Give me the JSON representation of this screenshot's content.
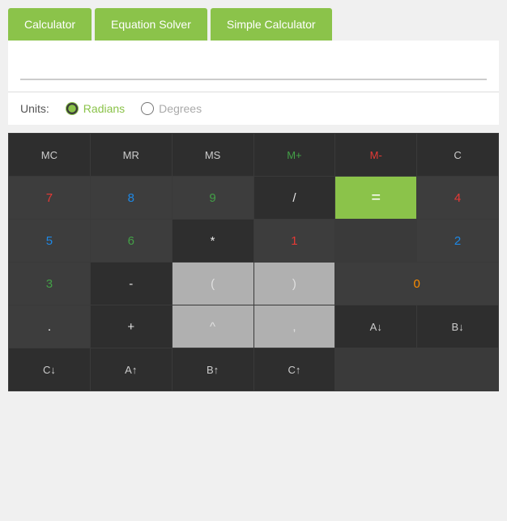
{
  "tabs": [
    {
      "label": "Calculator",
      "id": "calculator",
      "active": false
    },
    {
      "label": "Equation Solver",
      "id": "equation-solver",
      "active": true
    },
    {
      "label": "Simple Calculator",
      "id": "simple-calculator",
      "active": false
    }
  ],
  "display": {
    "value": "",
    "placeholder": ""
  },
  "units": {
    "label": "Units:",
    "options": [
      {
        "label": "Radians",
        "value": "radians",
        "checked": true
      },
      {
        "label": "Degrees",
        "value": "degrees",
        "checked": false
      }
    ]
  },
  "memory_row": [
    "MC",
    "MR",
    "MS",
    "M+",
    "M-",
    "C"
  ],
  "buttons": {
    "row1": [
      {
        "label": "7",
        "type": "number"
      },
      {
        "label": "8",
        "type": "number"
      },
      {
        "label": "9",
        "type": "number"
      },
      {
        "label": "/",
        "type": "operator-dark"
      },
      {
        "label": "=",
        "type": "equals",
        "rowspan": 2
      }
    ],
    "row2": [
      {
        "label": "4",
        "type": "number"
      },
      {
        "label": "5",
        "type": "number"
      },
      {
        "label": "6",
        "type": "number"
      },
      {
        "label": "*",
        "type": "operator-dark"
      }
    ],
    "row3": [
      {
        "label": "1",
        "type": "number"
      },
      {
        "label": "2",
        "type": "number"
      },
      {
        "label": "3",
        "type": "number"
      },
      {
        "label": "-",
        "type": "operator-dark"
      },
      {
        "label": "(",
        "type": "light-gray"
      },
      {
        "label": ")",
        "type": "light-gray"
      }
    ],
    "row4": [
      {
        "label": "0",
        "type": "number",
        "colspan": 2
      },
      {
        "label": ".",
        "type": "number"
      },
      {
        "label": "+",
        "type": "operator-dark"
      },
      {
        "label": "^",
        "type": "light-gray"
      },
      {
        "label": ",",
        "type": "light-gray"
      }
    ],
    "row5": [
      {
        "label": "A↓",
        "type": "bottom-dark"
      },
      {
        "label": "B↓",
        "type": "bottom-dark"
      },
      {
        "label": "C↓",
        "type": "bottom-dark"
      },
      {
        "label": "A↑",
        "type": "bottom-dark"
      },
      {
        "label": "B↑",
        "type": "bottom-dark"
      },
      {
        "label": "C↑",
        "type": "bottom-dark"
      }
    ]
  },
  "colors": {
    "green": "#8bc34a",
    "dark_bg": "#3d3d3d",
    "darker_bg": "#2e2e2e",
    "light_gray": "#b0b0b0"
  }
}
